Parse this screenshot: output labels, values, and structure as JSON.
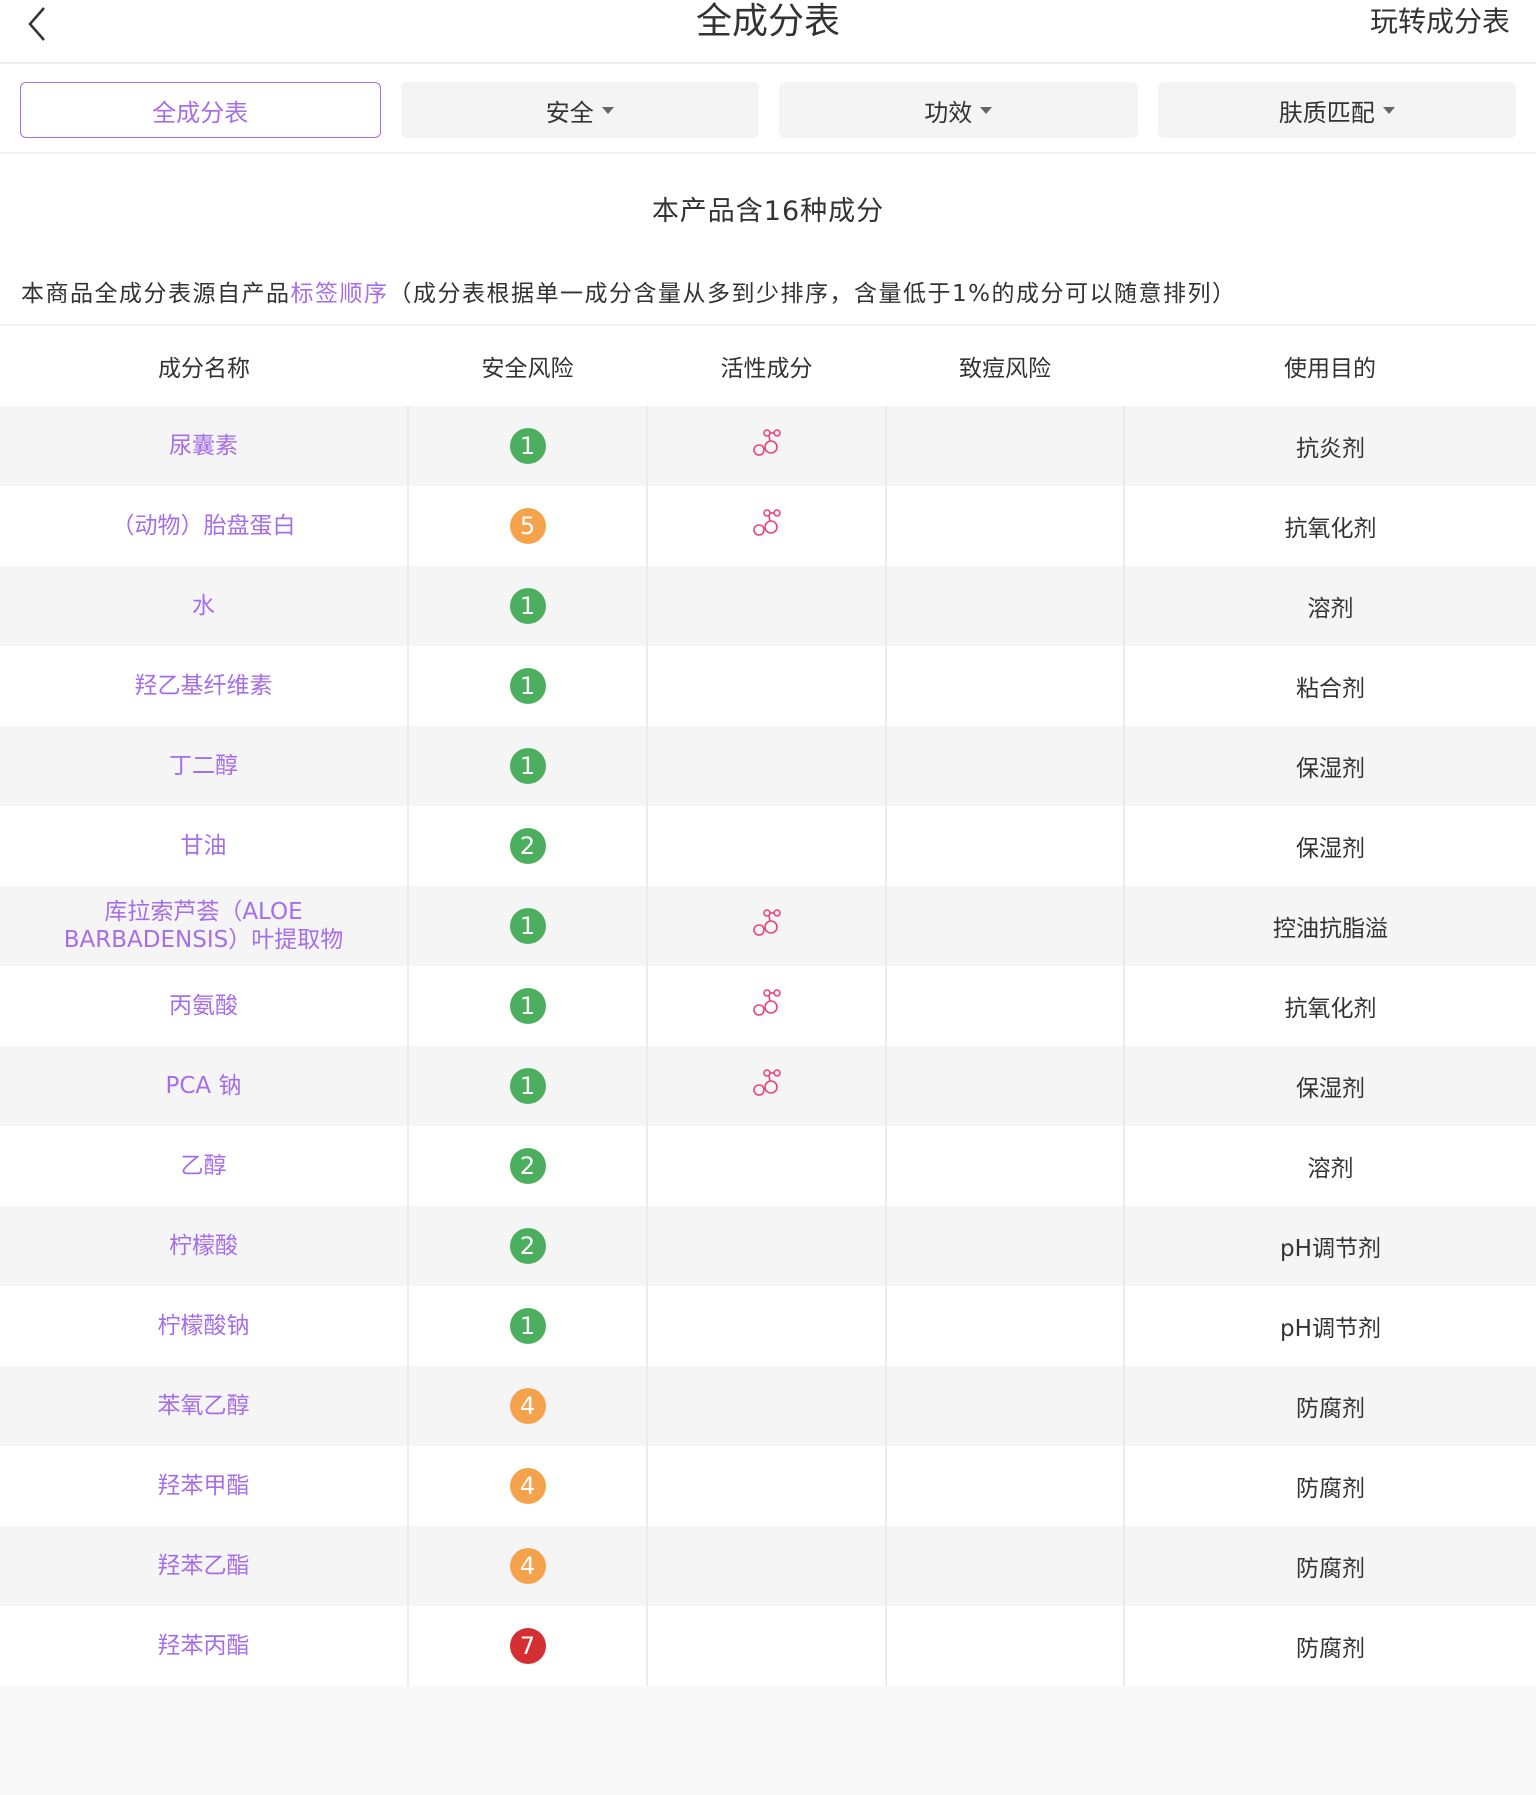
{
  "header": {
    "title": "全成分表",
    "right_link": "玩转成分表"
  },
  "tabs": [
    {
      "label": "全成分表",
      "active": true
    },
    {
      "label": "安全",
      "dropdown": true
    },
    {
      "label": "功效",
      "dropdown": true
    },
    {
      "label": "肤质匹配",
      "dropdown": true
    }
  ],
  "summary": {
    "count_text": "本产品含16种成分",
    "desc_prefix": "本商品全成分表源自产品",
    "desc_link": "标签顺序",
    "desc_suffix": "（成分表根据单一成分含量从多到少排序，含量低于1%的成分可以随意排列）"
  },
  "columns": [
    "成分名称",
    "安全风险",
    "活性成分",
    "致痘风险",
    "使用目的"
  ],
  "colors": {
    "accent": "#a66ee9",
    "risk_low": "#4caf5f",
    "risk_mid": "#f5a24c",
    "risk_high": "#d42f33",
    "active_icon": "#e8457a"
  },
  "rows": [
    {
      "name": "尿囊素",
      "risk": "1",
      "active": true,
      "purpose": "抗炎剂"
    },
    {
      "name": "（动物）胎盘蛋白",
      "risk": "5",
      "active": true,
      "purpose": "抗氧化剂"
    },
    {
      "name": "水",
      "risk": "1",
      "active": false,
      "purpose": "溶剂"
    },
    {
      "name": "羟乙基纤维素",
      "risk": "1",
      "active": false,
      "purpose": "粘合剂"
    },
    {
      "name": "丁二醇",
      "risk": "1",
      "active": false,
      "purpose": "保湿剂"
    },
    {
      "name": "甘油",
      "risk": "2",
      "active": false,
      "purpose": "保湿剂"
    },
    {
      "name": "库拉索芦荟（ALOE BARBADENSIS）叶提取物",
      "risk": "1",
      "active": true,
      "purpose": "控油抗脂溢"
    },
    {
      "name": "丙氨酸",
      "risk": "1",
      "active": true,
      "purpose": "抗氧化剂"
    },
    {
      "name": "PCA 钠",
      "risk": "1",
      "active": true,
      "purpose": "保湿剂"
    },
    {
      "name": "乙醇",
      "risk": "2",
      "active": false,
      "purpose": "溶剂"
    },
    {
      "name": "柠檬酸",
      "risk": "2",
      "active": false,
      "purpose": "pH调节剂"
    },
    {
      "name": "柠檬酸钠",
      "risk": "1",
      "active": false,
      "purpose": "pH调节剂"
    },
    {
      "name": "苯氧乙醇",
      "risk": "4",
      "active": false,
      "purpose": "防腐剂"
    },
    {
      "name": "羟苯甲酯",
      "risk": "4",
      "active": false,
      "purpose": "防腐剂"
    },
    {
      "name": "羟苯乙酯",
      "risk": "4",
      "active": false,
      "purpose": "防腐剂"
    },
    {
      "name": "羟苯丙酯",
      "risk": "7",
      "active": false,
      "purpose": "防腐剂"
    }
  ]
}
